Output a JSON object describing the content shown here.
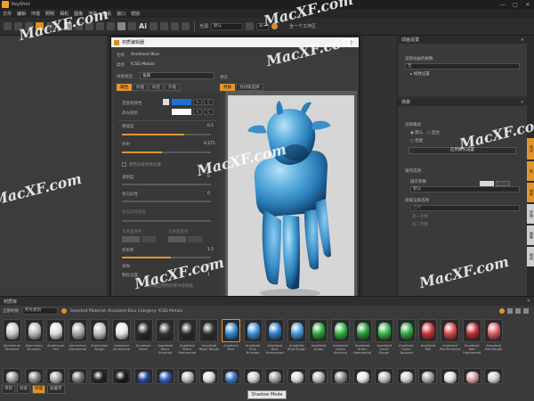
{
  "app": {
    "title": "KeyShot",
    "menu": [
      "文件",
      "编辑",
      "环境",
      "照明",
      "相机",
      "图像",
      "渲染",
      "查看",
      "窗口",
      "帮助"
    ],
    "toolbar": {
      "mode_label": "光源",
      "mode_value": "默认",
      "zoom_value": "光~",
      "render_label": "全一个工作区"
    }
  },
  "right_panel_top": {
    "title": "动画设置",
    "field_label": "渲染动画的帧数",
    "field_value": "无",
    "expander": "▸ 帧数设置"
  },
  "right_panel_main": {
    "title": "场景",
    "section1": "渲染模式",
    "options": [
      "默认",
      "后台",
      "性能"
    ],
    "button": "应用默认设置",
    "section2": "操作选项",
    "sub_label": "操作参数",
    "sub_value": "默认",
    "section3": "高级渲染选项",
    "check_label": "启用",
    "opts": [
      "第一参数",
      "第二参数"
    ]
  },
  "vertical_tabs": [
    "项目",
    "库",
    "材质",
    "环境",
    "图像",
    "相机"
  ],
  "dialog": {
    "title": "材质编辑器",
    "name_label": "名称",
    "name_value": "Anodized Blue",
    "type_label": "类别",
    "type_value": "ICSD Metals",
    "material_type_label": "材质类型",
    "material_type_value": "金属",
    "tabs": [
      "属性",
      "纹理",
      "标签",
      "外观"
    ],
    "props": {
      "color_label": "漫反射颜色",
      "color_hex": "#1f6fd1",
      "spec_label": "高光颜色",
      "spec_hex": "#ffffff",
      "roughness_label": "粗糙度",
      "roughness_value": "0.1",
      "refraction_label": "折射",
      "refraction_value": "0.271",
      "checkbox_label": "使用高级参数设置",
      "slider3_label": "透明度",
      "slider3_value": "0",
      "slider4_label": "各向异性",
      "slider4_value": "0",
      "slider5_label": "各向异性角度",
      "slider6_label": "次表面颜色",
      "slider6b_label": "次表面颜色",
      "ior_label": "折射率",
      "ior_value": "1.5",
      "samples_label": "采样",
      "samples_value": "8",
      "grain_label": "颗粒设置",
      "grain_value": "1",
      "note": "修改将应用到场景中该材质"
    },
    "preview_tabs": [
      "材质",
      "为材质选择"
    ],
    "preview_label": "预览",
    "footer_left": "◉ 预览选项",
    "footer_right": "关闭"
  },
  "library": {
    "title": "材质库",
    "bar_label": "全部材质",
    "bar_drop": "所有类别",
    "path": "Selected Material: Anodized Blue  Category: ICSD Metals",
    "tabs": [
      "项目",
      "材质",
      "纹理",
      "收藏夹"
    ],
    "items": [
      {
        "name": "Aluminium Brushed",
        "color": "#c8c8c8"
      },
      {
        "name": "Aluminium Brushed",
        "color": "#b8b8b8"
      },
      {
        "name": "Aluminium Foil",
        "color": "#dcdcdc"
      },
      {
        "name": "Aluminium Hammered",
        "color": "#a8a8a8"
      },
      {
        "name": "Aluminium Rough",
        "color": "#bcbcbc"
      },
      {
        "name": "Anodized Aluminium",
        "color": "#e4e4e4"
      },
      {
        "name": "Anodized Black",
        "color": "#262626"
      },
      {
        "name": "Anodized Black Brushed",
        "color": "#333333"
      },
      {
        "name": "Anodized Black Hammered",
        "color": "#2a2a2a"
      },
      {
        "name": "Anodized Black Rough",
        "color": "#303030"
      },
      {
        "name": "Anodized Blue",
        "color": "#2f86cf"
      },
      {
        "name": "Anodized Blue Brushed",
        "color": "#3a8fd6"
      },
      {
        "name": "Anodized Blue Hammered",
        "color": "#2d7ec4"
      },
      {
        "name": "Anodized Blue Rough",
        "color": "#4495d4"
      },
      {
        "name": "Anodized Green",
        "color": "#27a43a"
      },
      {
        "name": "Anodized Green Brushed",
        "color": "#2fb044"
      },
      {
        "name": "Anodized Green Hammered",
        "color": "#249a35"
      },
      {
        "name": "Anodized Green Rough",
        "color": "#35b449"
      },
      {
        "name": "Anodized Green Squared",
        "color": "#2ca63e"
      },
      {
        "name": "Anodized Red",
        "color": "#c8303a"
      },
      {
        "name": "Anodized Red Brushed",
        "color": "#d2444c"
      },
      {
        "name": "Anodized Red Hammered",
        "color": "#b92c36"
      },
      {
        "name": "Anodized Red Rough",
        "color": "#d65a60"
      }
    ],
    "row2_colors": [
      "#9a9a9a",
      "#888888",
      "#aaaaaa",
      "#777777",
      "#232323",
      "#1a1a1a",
      "#2a4a9a",
      "#355fc0",
      "#bcbcbc",
      "#dddddd",
      "#3a7ac6",
      "#cfcfcf",
      "#a0a0a0",
      "#d8d8d8",
      "#b8b8b8",
      "#8f8f8f",
      "#e6e6e6",
      "#c0c0c0",
      "#d0d0d0",
      "#a8a8a8",
      "#e0e0e0",
      "#d9a0a0",
      "#cfcfcf"
    ],
    "shadow_mode": "Shadow Mode"
  },
  "watermark": "MacXF.com"
}
